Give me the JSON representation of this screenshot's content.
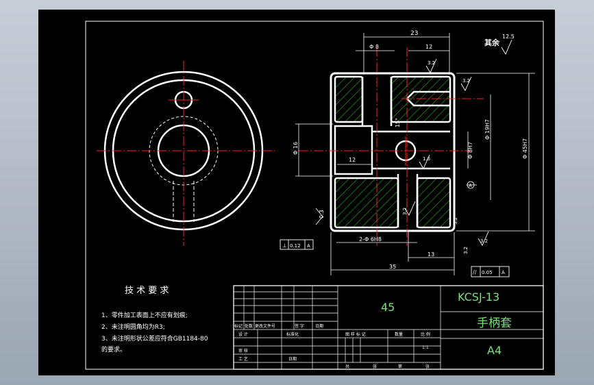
{
  "colors": {
    "background": "#000000",
    "outline": "#ffffff",
    "centerline": "#ff2020",
    "hatch": "#29d629",
    "title_text": "#7de07d",
    "window": "#b3bcc7"
  },
  "notes": {
    "heading": "技 术 要 求",
    "items": [
      "1、零件加工表面上不应有划痕;",
      "2、未注明圆角均为R3;",
      "3、未注明形状公差应符合GB1184-80",
      "的要求。"
    ]
  },
  "roughness": {
    "other_label": "其余",
    "other_value": "12.5",
    "values": [
      "3.2",
      "3.2",
      "1.6",
      "3.2",
      "3.2",
      "3.2"
    ]
  },
  "dimensions": {
    "top_overall": "23",
    "top_left": "Φ 8",
    "top_right": "12",
    "left_height": "Φ 16",
    "inner_slot": "12",
    "right_mid": "Φ 8H7",
    "right_upper": "Φ 19H7",
    "right_overall": "Φ 45H7",
    "chamfer": "0.3",
    "angle": "15°",
    "bottom_holes": "2-Φ 6H8",
    "bottom_overall": "35",
    "bottom_right": "13",
    "corner": "3.2"
  },
  "datum": {
    "label": "A"
  },
  "tolerances": {
    "flatness": {
      "symbol": "⊥",
      "value": "0.12",
      "datum": "A"
    },
    "parallel": {
      "symbol": "//",
      "value": "0.05",
      "datum": "A"
    }
  },
  "title_block": {
    "material": "45",
    "drawing_no": "KCSJ-13",
    "part_name": "手柄套",
    "sheet_size": "A4",
    "scale": "1:1",
    "row_labels": {
      "mark": "标记",
      "count": "处数",
      "change_doc": "更改文件号",
      "sign": "签 字",
      "date": "日期",
      "design": "设 计",
      "standardize": "标准化",
      "review": "审 核",
      "process": "工 艺",
      "date2": "日期",
      "stage_mark": "图 样 标 记",
      "qty": "数量",
      "ratio": "比 例",
      "total": "共",
      "sheets": "张",
      "page": "第",
      "sheets2": "张"
    }
  }
}
